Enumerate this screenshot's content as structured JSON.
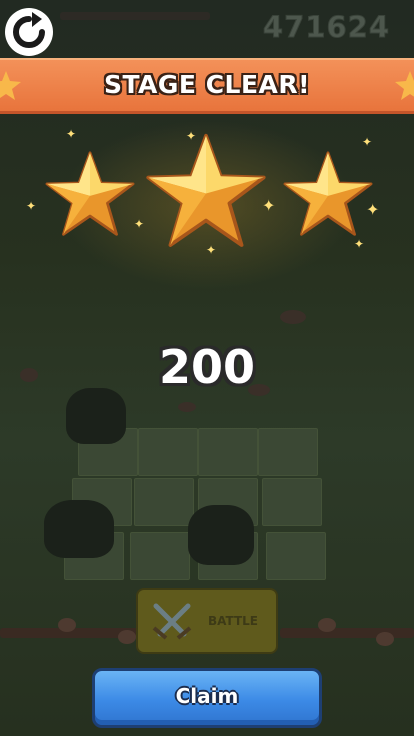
{
  "hud": {
    "score": "471624",
    "refresh_icon": "refresh-icon"
  },
  "banner": {
    "title": "STAGE CLEAR!",
    "decor_icon": "star-icon"
  },
  "result": {
    "stars_earned": 3,
    "stars_total": 3,
    "star_icon": "star-icon",
    "reward_amount": "200"
  },
  "background_ui": {
    "battle_label": "BATTLE",
    "battle_icon": "crossed-swords-icon"
  },
  "actions": {
    "claim_label": "Claim"
  },
  "colors": {
    "banner": "#e8743c",
    "claim_button": "#3c8ae6",
    "star_gold": "#f7b733"
  }
}
